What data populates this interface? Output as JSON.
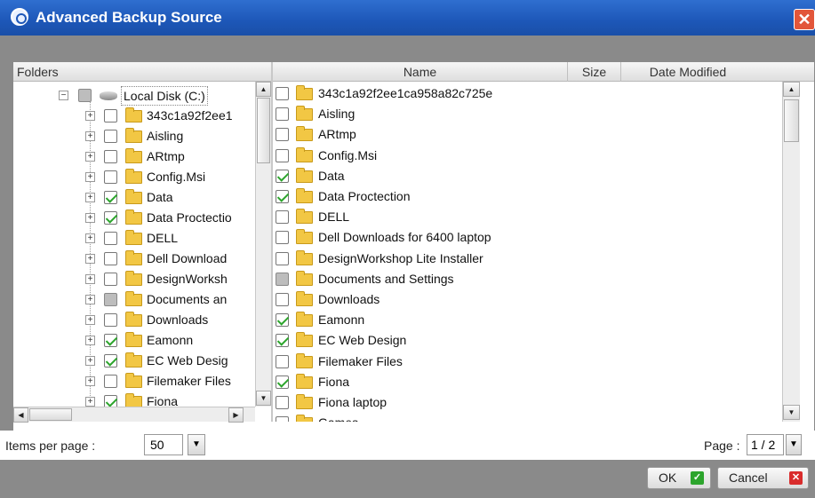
{
  "window": {
    "title": "Advanced Backup Source",
    "close_glyph": "✕"
  },
  "tree": {
    "header": "Folders",
    "root": {
      "label": "Local Disk (C:)",
      "state": "partial"
    },
    "items": [
      {
        "label": "343c1a92f2ee1",
        "state": "unchecked"
      },
      {
        "label": "Aisling",
        "state": "unchecked"
      },
      {
        "label": "ARtmp",
        "state": "unchecked"
      },
      {
        "label": "Config.Msi",
        "state": "unchecked"
      },
      {
        "label": "Data",
        "state": "checked"
      },
      {
        "label": "Data Proctectio",
        "state": "checked"
      },
      {
        "label": "DELL",
        "state": "unchecked"
      },
      {
        "label": "Dell Download",
        "state": "unchecked"
      },
      {
        "label": "DesignWorksh",
        "state": "unchecked"
      },
      {
        "label": "Documents an",
        "state": "partial"
      },
      {
        "label": "Downloads",
        "state": "unchecked"
      },
      {
        "label": "Eamonn",
        "state": "checked"
      },
      {
        "label": "EC Web Desig",
        "state": "checked"
      },
      {
        "label": "Filemaker Files",
        "state": "unchecked"
      },
      {
        "label": "Fiona",
        "state": "checked"
      }
    ]
  },
  "list": {
    "columns": {
      "name": "Name",
      "size": "Size",
      "date": "Date Modified"
    },
    "items": [
      {
        "label": "343c1a92f2ee1ca958a82c725e",
        "state": "unchecked"
      },
      {
        "label": "Aisling",
        "state": "unchecked"
      },
      {
        "label": "ARtmp",
        "state": "unchecked"
      },
      {
        "label": "Config.Msi",
        "state": "unchecked"
      },
      {
        "label": "Data",
        "state": "checked"
      },
      {
        "label": "Data Proctection",
        "state": "checked"
      },
      {
        "label": "DELL",
        "state": "unchecked"
      },
      {
        "label": "Dell Downloads for 6400 laptop",
        "state": "unchecked"
      },
      {
        "label": "DesignWorkshop Lite Installer",
        "state": "unchecked"
      },
      {
        "label": "Documents and Settings",
        "state": "partial"
      },
      {
        "label": "Downloads",
        "state": "unchecked"
      },
      {
        "label": "Eamonn",
        "state": "checked"
      },
      {
        "label": "EC Web Design",
        "state": "checked"
      },
      {
        "label": "Filemaker Files",
        "state": "unchecked"
      },
      {
        "label": "Fiona",
        "state": "checked"
      },
      {
        "label": "Fiona laptop",
        "state": "unchecked"
      },
      {
        "label": "Games",
        "state": "unchecked"
      }
    ]
  },
  "footer": {
    "items_per_page_label": "Items per page :",
    "items_per_page_value": "50",
    "page_label": "Page :",
    "page_value": "1 / 2"
  },
  "buttons": {
    "ok": "OK",
    "cancel": "Cancel"
  },
  "colors": {
    "titlebar": "#1d57b8",
    "check": "#2da52d",
    "folder": "#f2c744",
    "ok_icon": "#2da52d",
    "cancel_icon": "#d92c2c"
  }
}
